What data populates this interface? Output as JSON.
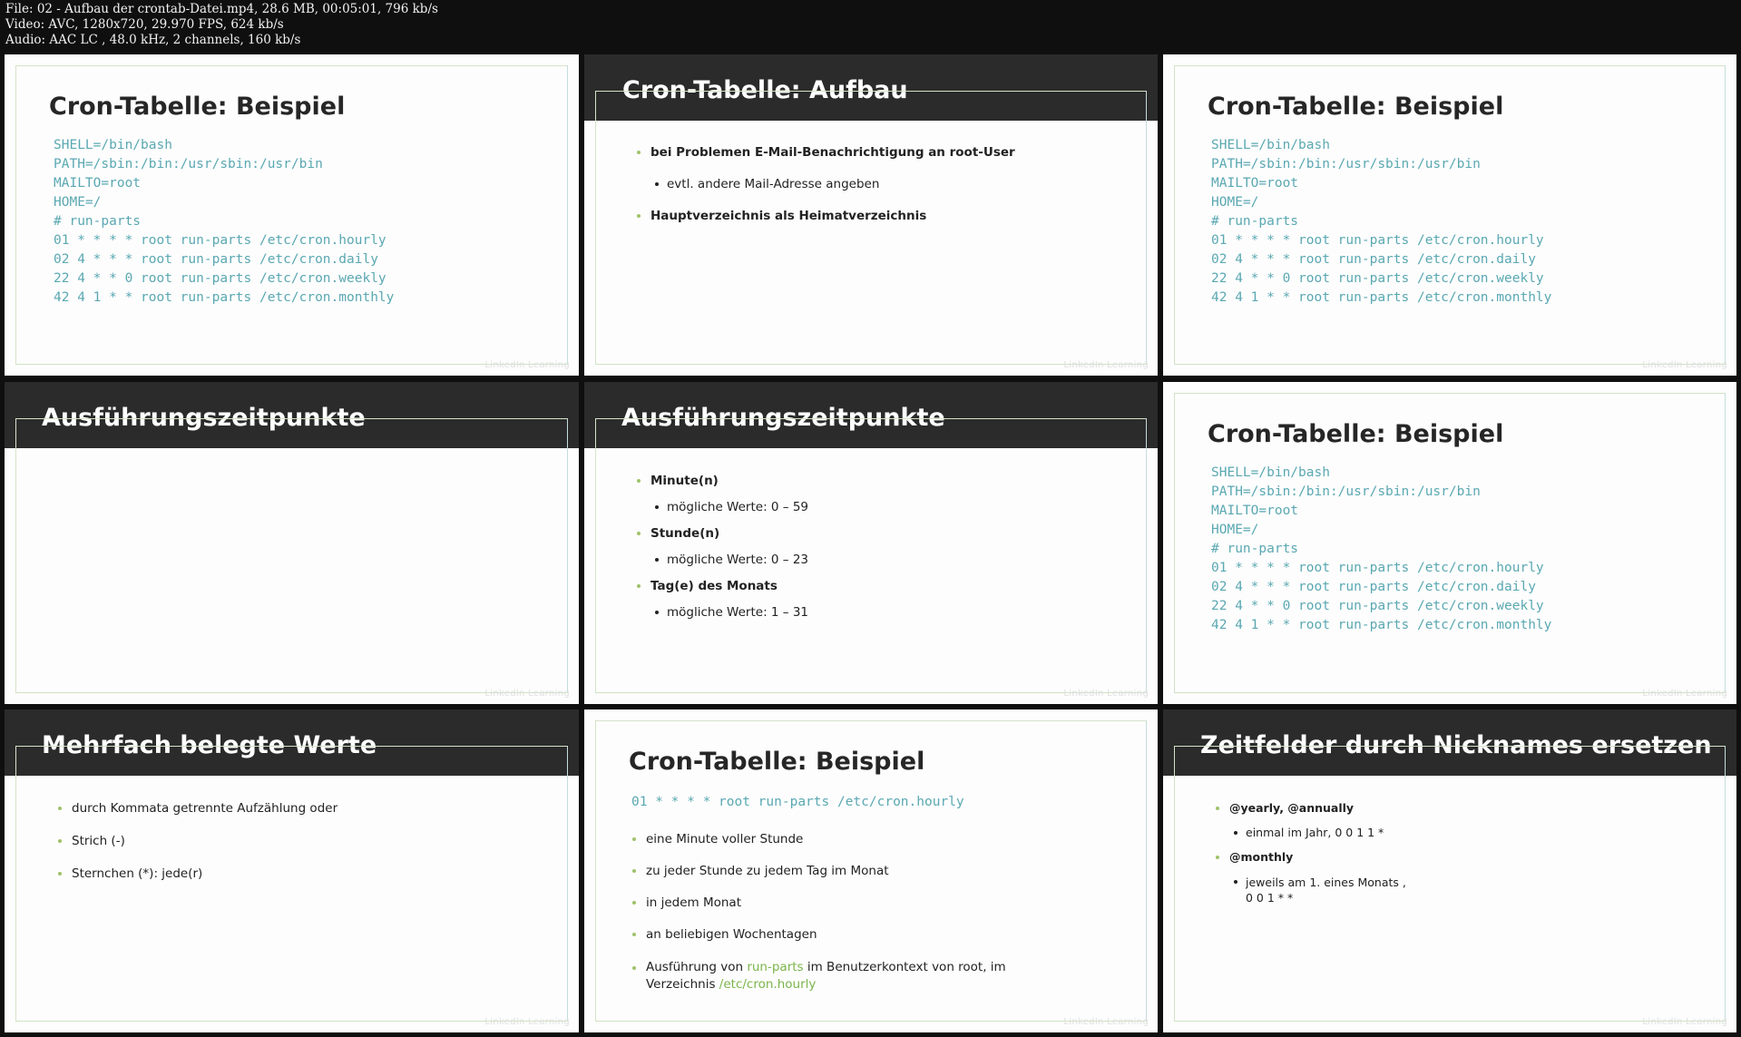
{
  "file_info": {
    "line1": "File: 02 - Aufbau der crontab-Datei.mp4, 28.6 MB, 00:05:01, 796 kb/s",
    "line2": "Video: AVC, 1280x720, 29.970 FPS, 624 kb/s",
    "line3": "Audio: AAC LC , 48.0 kHz, 2 channels, 160 kb/s"
  },
  "watermark": "LinkedIn Learning",
  "slides": {
    "s1": {
      "title": "Cron-Tabelle: Beispiel",
      "code": [
        "SHELL=/bin/bash",
        "PATH=/sbin:/bin:/usr/sbin:/usr/bin",
        "MAILTO=root",
        "HOME=/",
        "# run-parts",
        "01 * * * * root run-parts /etc/cron.hourly",
        "02 4 * * * root run-parts /etc/cron.daily",
        "22 4 * * 0 root run-parts /etc/cron.weekly",
        "42 4 1 * * root run-parts /etc/cron.monthly"
      ]
    },
    "s2": {
      "title": "Cron-Tabelle: Aufbau",
      "b1": "bei Problemen E-Mail-Benachrichtigung an root-User",
      "b1_sub": "evtl. andere Mail-Adresse angeben",
      "b2": "Hauptverzeichnis als Heimatverzeichnis"
    },
    "s3": {
      "title": "Cron-Tabelle: Beispiel",
      "code": [
        "SHELL=/bin/bash",
        "PATH=/sbin:/bin:/usr/sbin:/usr/bin",
        "MAILTO=root",
        "HOME=/",
        "# run-parts",
        "01 * * * * root run-parts /etc/cron.hourly",
        "02 4 * * * root run-parts /etc/cron.daily",
        "22 4 * * 0 root run-parts /etc/cron.weekly",
        "42 4 1 * * root run-parts /etc/cron.monthly"
      ]
    },
    "s4": {
      "title": "Ausführungszeitpunkte"
    },
    "s5": {
      "title": "Ausführungszeitpunkte",
      "b1": "Minute(n)",
      "b1_sub": "mögliche Werte: 0 – 59",
      "b2": "Stunde(n)",
      "b2_sub": "mögliche Werte: 0 – 23",
      "b3": "Tag(e) des Monats",
      "b3_sub": "mögliche Werte: 1 – 31"
    },
    "s6": {
      "title": "Cron-Tabelle: Beispiel",
      "code": [
        "SHELL=/bin/bash",
        "PATH=/sbin:/bin:/usr/sbin:/usr/bin",
        "MAILTO=root",
        "HOME=/",
        "# run-parts",
        "01 * * * * root run-parts /etc/cron.hourly",
        "02 4 * * * root run-parts /etc/cron.daily",
        "22 4 * * 0 root run-parts /etc/cron.weekly",
        "42 4 1 * * root run-parts /etc/cron.monthly"
      ]
    },
    "s7": {
      "title": "Mehrfach belegte Werte",
      "b1": "durch Kommata getrennte Aufzählung oder",
      "b2": "Strich (-)",
      "b3": "Sternchen (*): jede(r)"
    },
    "s8": {
      "title": "Cron-Tabelle: Beispiel",
      "code": "01 * * * * root run-parts /etc/cron.hourly",
      "b1": "eine Minute voller Stunde",
      "b2": "zu jeder Stunde zu jedem Tag im Monat",
      "b3": "in jedem Monat",
      "b4": "an beliebigen Wochentagen",
      "b5_a": "Ausführung von ",
      "b5_b": "run-parts",
      "b5_c": " im Benutzerkontext von root, im",
      "b5_d": "Verzeichnis ",
      "b5_e": "/etc/cron.hourly"
    },
    "s9": {
      "title": "Zeitfelder durch Nicknames ersetzen",
      "b1": "@yearly, @annually",
      "b1_sub": "einmal im Jahr, 0 0 1 1 *",
      "b2": "@monthly",
      "b2_sub_a": "jeweils am 1. eines Monats ,",
      "b2_sub_b": "0 0 1 * *"
    }
  }
}
